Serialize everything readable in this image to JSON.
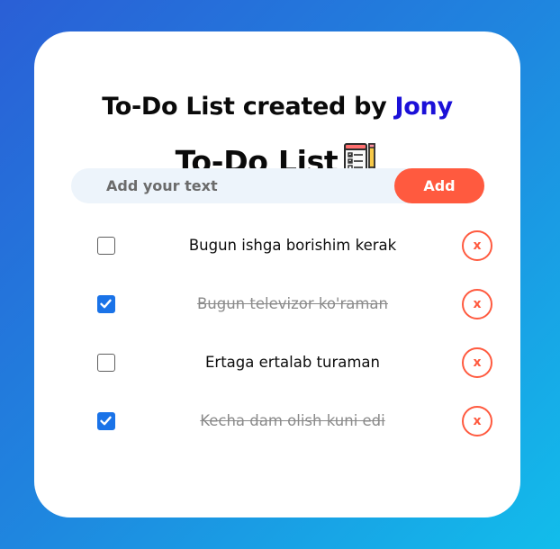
{
  "header": {
    "title_prefix": "To-Do List created by ",
    "author": "Jony",
    "subtitle": "To-Do List"
  },
  "input": {
    "placeholder": "Add your text",
    "value": "",
    "add_label": "Add"
  },
  "tasks": [
    {
      "text": "Bugun ishga borishim kerak",
      "checked": false,
      "delete_label": "x"
    },
    {
      "text": "Bugun televizor ko'raman",
      "checked": true,
      "delete_label": "x"
    },
    {
      "text": "Ertaga ertalab turaman",
      "checked": false,
      "delete_label": "x"
    },
    {
      "text": "Kecha dam olish kuni edi",
      "checked": true,
      "delete_label": "x"
    }
  ],
  "colors": {
    "accent": "#ff5a3f",
    "author": "#1b10d8",
    "checkbox_checked": "#1a73e8"
  }
}
